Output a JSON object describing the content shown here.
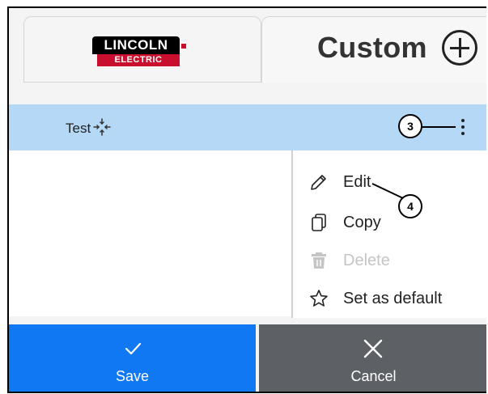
{
  "tabs": {
    "brand": {
      "logo_top": "LINCOLN",
      "logo_bottom": "ELECTRIC"
    },
    "custom": {
      "label": "Custom",
      "add_icon": "plus-circle-icon"
    }
  },
  "list": {
    "selected_row": {
      "name": "Test",
      "icon": "collapse-arrows-icon",
      "menu_icon": "more-vertical-icon"
    }
  },
  "context_menu": {
    "items": [
      {
        "label": "Edit",
        "icon": "pencil-icon",
        "enabled": true
      },
      {
        "label": "Copy",
        "icon": "copy-icon",
        "enabled": true
      },
      {
        "label": "Delete",
        "icon": "trash-icon",
        "enabled": false
      },
      {
        "label": "Set as default",
        "icon": "star-outline-icon",
        "enabled": true
      }
    ]
  },
  "callouts": {
    "kebab": "3",
    "edit": "4"
  },
  "footer": {
    "save": {
      "label": "Save",
      "icon": "check-icon",
      "color": "#1078f2"
    },
    "cancel": {
      "label": "Cancel",
      "icon": "close-icon",
      "color": "#5d6166"
    }
  },
  "colors": {
    "selected_row": "#b6d8f7",
    "brand_red": "#c8102e"
  }
}
